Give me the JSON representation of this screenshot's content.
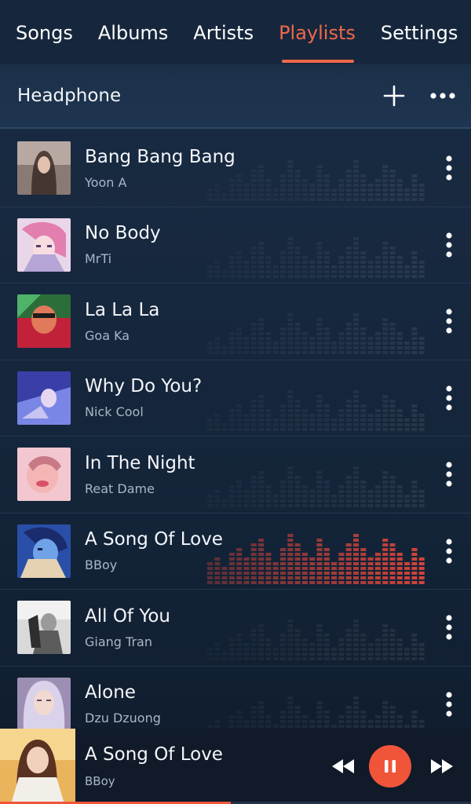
{
  "tabs": [
    {
      "label": "Songs"
    },
    {
      "label": "Albums"
    },
    {
      "label": "Artists"
    },
    {
      "label": "Playlists",
      "active": true
    },
    {
      "label": "Settings"
    }
  ],
  "playlist": {
    "title": "Headphone",
    "add_icon": "plus-icon",
    "menu_icon": "more-horizontal-icon"
  },
  "songs": [
    {
      "title": "Bang Bang Bang",
      "artist": "Yoon A"
    },
    {
      "title": "No Body",
      "artist": "MrTi"
    },
    {
      "title": "La La La",
      "artist": "Goa Ka"
    },
    {
      "title": "Why Do You?",
      "artist": "Nick Cool"
    },
    {
      "title": "In The Night",
      "artist": "Reat Dame"
    },
    {
      "title": "A Song Of Love",
      "artist": "BBoy",
      "playing": true
    },
    {
      "title": "All Of You",
      "artist": "Giang Tran"
    },
    {
      "title": "Alone",
      "artist": "Dzu Dzuong"
    }
  ],
  "now_playing": {
    "title": "A Song Of Love",
    "artist": "BBoy",
    "progress": 0.49
  },
  "colors": {
    "accent": "#f0684a",
    "pause_button": "#f0553a",
    "background": "#16263a",
    "text": "#f4f6fa",
    "subtext": "#a9b6c6"
  }
}
